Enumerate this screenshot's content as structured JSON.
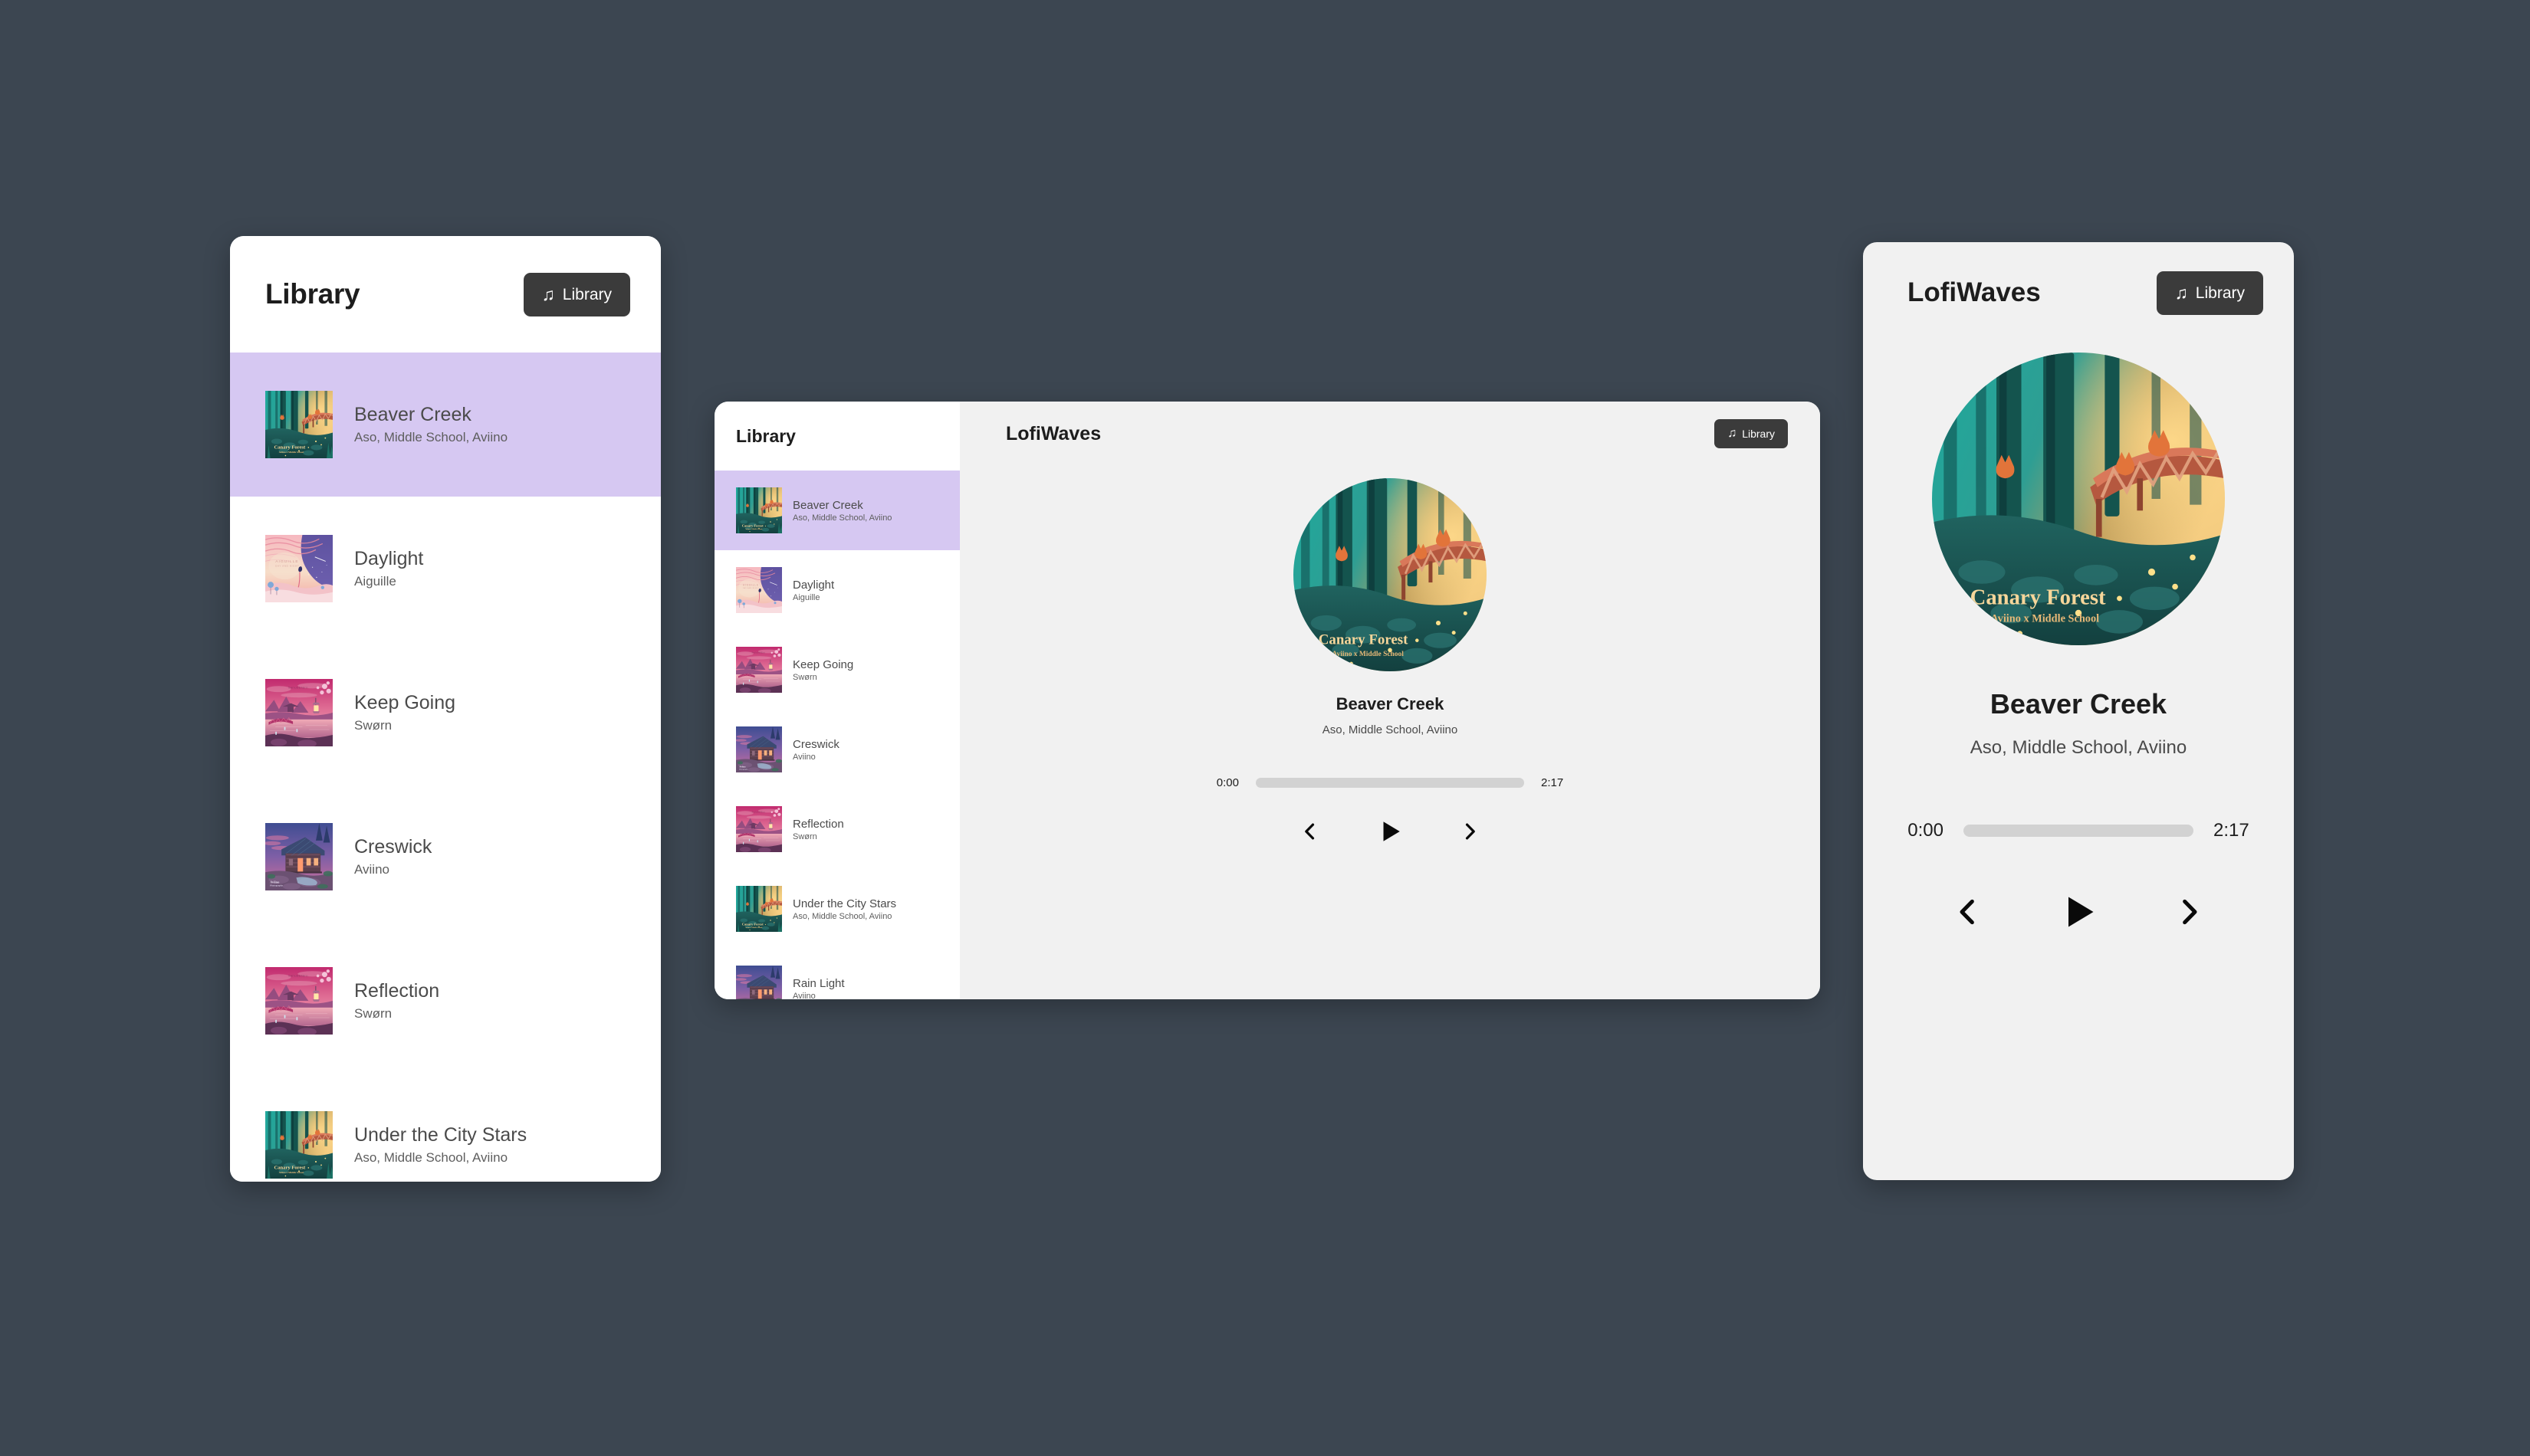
{
  "background_color": "#3c4651",
  "accent_highlight_color": "#d6c8f2",
  "button_color": "#3b3b3b",
  "library_button": {
    "label": "Library",
    "icon": "music-note-icon"
  },
  "desktop": {
    "title": "Library",
    "library_button_label": "Library"
  },
  "tablet": {
    "sidebar_title": "Library",
    "brand": "LofiWaves",
    "library_button_label": "Library"
  },
  "mobile": {
    "brand": "LofiWaves",
    "library_button_label": "Library"
  },
  "now_playing": {
    "title": "Beaver Creek",
    "artists": "Aso, Middle School, Aviino",
    "current_time": "0:00",
    "duration": "2:17",
    "progress_percent": 0,
    "is_playing": false,
    "cover_title": "Canary Forest",
    "cover_subtitle": "Aviino x Middle School"
  },
  "controls": {
    "previous": "skip-back-icon",
    "play": "play-icon",
    "next": "skip-forward-icon"
  },
  "library": {
    "items": [
      {
        "title": "Beaver Creek",
        "artist": "Aso, Middle School, Aviino",
        "art": "forest",
        "active": true
      },
      {
        "title": "Daylight",
        "artist": "Aiguille",
        "art": "daylight",
        "active": false
      },
      {
        "title": "Keep Going",
        "artist": "Swørn",
        "art": "pinkland",
        "active": false
      },
      {
        "title": "Creswick",
        "artist": "Aviino",
        "art": "cabin",
        "active": false
      },
      {
        "title": "Reflection",
        "artist": "Swørn",
        "art": "pinkland",
        "active": false
      },
      {
        "title": "Under the City Stars",
        "artist": "Aso, Middle School, Aviino",
        "art": "forest",
        "active": false
      },
      {
        "title": "Rain Light",
        "artist": "Aviino",
        "art": "cabin",
        "active": false
      }
    ]
  }
}
